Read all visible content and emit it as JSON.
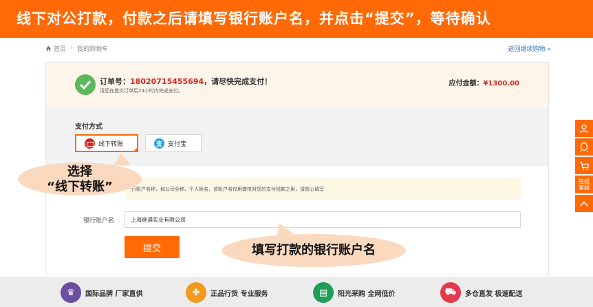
{
  "banner": {
    "text": "线下对公打款，付款之后请填写银行账户名，并点击“提交”，等待确认"
  },
  "breadcrumb": {
    "home": "首页",
    "current": "我的购物车",
    "back_link": "返回继续购物 »"
  },
  "order": {
    "label": "订单号：",
    "number": "18020715455694",
    "message": "，请尽快完成支付！",
    "sub": "请您在提交订单后24小时内完成支付。",
    "amount_label": "应付金额：",
    "amount_value": "¥1300.00"
  },
  "payment": {
    "title": "支付方式",
    "options": [
      {
        "label": "线下转账",
        "icon": "bank-card-icon",
        "selected": true
      },
      {
        "label": "支付宝",
        "icon": "alipay-icon",
        "selected": false
      }
    ]
  },
  "form": {
    "notice": "行账户名称，如公司全称、个人姓名，该账户名仅用做核对您的支付钱款之用，请放心填写",
    "account_label": "银行账户名",
    "account_value": "上海继浦实业有限公司",
    "submit_label": "提交"
  },
  "annotations": {
    "left_line1": "选择",
    "left_line2": "“线下转账”",
    "right": "填写打款的银行账户名"
  },
  "footer": {
    "features": [
      {
        "label": "国际品牌 厂家直供",
        "icon": "crown-icon",
        "color": "#6b4fa0"
      },
      {
        "label": "正品行货 专业服务",
        "icon": "clover-icon",
        "color": "#f39a1e"
      },
      {
        "label": "阳光采购 全网低价",
        "icon": "store-icon",
        "color": "#1f9e5a"
      },
      {
        "label": "多仓直发 极速配送",
        "icon": "truck-icon",
        "color": "#e23b4e"
      }
    ]
  },
  "sidebar": {
    "items": [
      {
        "icon": "user-icon"
      },
      {
        "icon": "qq-icon"
      },
      {
        "icon": "cart-icon"
      },
      {
        "label_line1": "在线",
        "label_line2": "客服"
      },
      {
        "icon": "chevron-up-icon"
      }
    ]
  },
  "colors": {
    "accent": "#ff6a06",
    "price": "#d9261c",
    "success": "#5cb85c",
    "bubble": "#fbd9bf"
  }
}
